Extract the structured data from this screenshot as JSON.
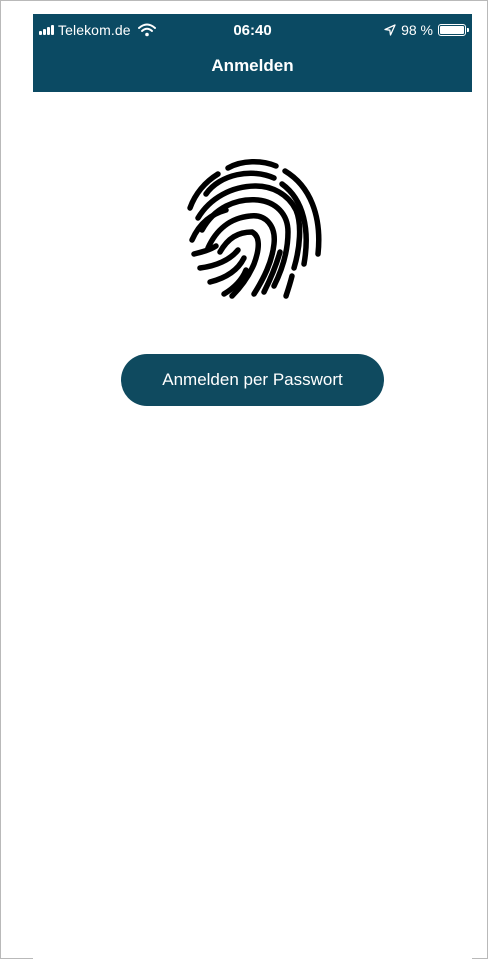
{
  "status_bar": {
    "carrier": "Telekom.de",
    "time": "06:40",
    "battery_percent": "98 %",
    "battery_level": 0.98,
    "icons": [
      "signal-icon",
      "wifi-icon",
      "location-arrow-icon",
      "battery-icon"
    ]
  },
  "nav": {
    "title": "Anmelden"
  },
  "main": {
    "fingerprint_icon": "fingerprint-icon",
    "password_button_label": "Anmelden per Passwort"
  },
  "colors": {
    "header_background": "#0b4a63",
    "button_background": "#0f4a5f",
    "fingerprint": "#000000",
    "text_on_dark": "#ffffff"
  }
}
